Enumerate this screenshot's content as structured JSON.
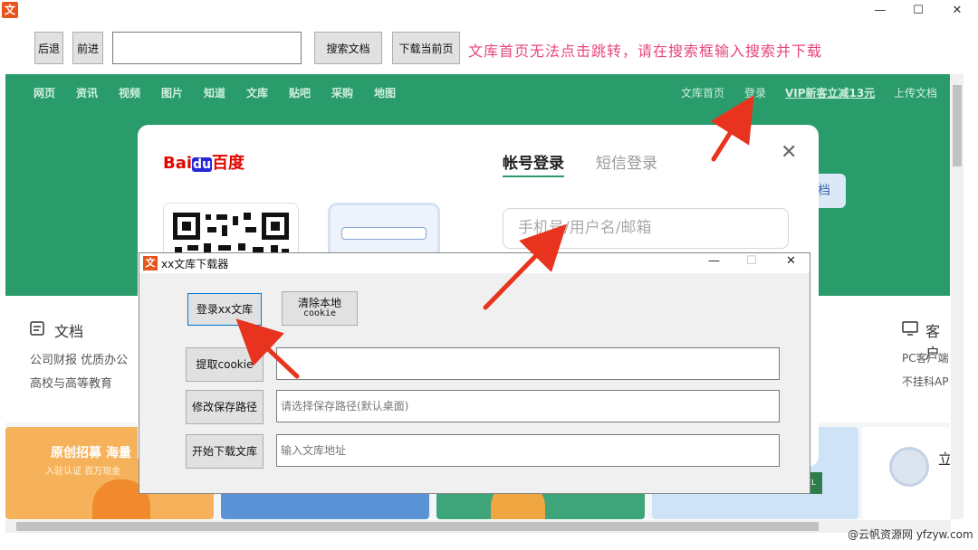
{
  "window": {
    "app_icon": "文",
    "minimize": "—",
    "maximize": "☐",
    "close": "✕"
  },
  "toolbar": {
    "back_label": "后退",
    "forward_label": "前进",
    "url_value": "",
    "search_label": "搜索文档",
    "download_page_label": "下载当前页",
    "notice": "文库首页无法点击跳转，请在搜索框输入搜索并下载"
  },
  "web": {
    "nav": [
      "网页",
      "资讯",
      "视频",
      "图片",
      "知道",
      "文库",
      "贴吧",
      "采购",
      "地图"
    ],
    "nav_right": {
      "home": "文库首页",
      "login": "登录",
      "vip": "VIP新客立减13元",
      "upload": "上传文档"
    },
    "side_button": "档",
    "docs_section": {
      "title": "文档",
      "line1": "公司财报   优质办公",
      "line2": "高校与高等教育"
    },
    "client_section": {
      "title": "客户",
      "line1": "PC客户端",
      "line2": "不挂科AP"
    },
    "banner_text": {
      "title": "原创招募 海量",
      "sub": "入驻认证 百万现金",
      "right": "立"
    }
  },
  "login_modal": {
    "logo_bai": "Bai",
    "logo_du": "du",
    "logo_cn": "百度",
    "tab_account": "帐号登录",
    "tab_sms": "短信登录",
    "username_placeholder": "手机号/用户名/邮箱",
    "close": "✕"
  },
  "downloader": {
    "title": "xx文库下载器",
    "controls": {
      "minimize": "—",
      "maximize": "☐",
      "close": "✕"
    },
    "login_button": "登录xx文库",
    "clear_cookie_line1": "清除本地",
    "clear_cookie_line2": "cookie",
    "extract_cookie": "提取cookie",
    "cookie_value": "",
    "change_path": "修改保存路径",
    "path_placeholder": "请选择保存路径(默认桌面)",
    "start_download": "开始下载文库",
    "url_placeholder": "输入文库地址"
  },
  "watermark": "@云帆资源网 yfzyw.com",
  "colors": {
    "header_green": "#2a9c6b",
    "notice_pink": "#e8467a",
    "arrow_red": "#e8341e",
    "app_orange": "#e8541e"
  }
}
